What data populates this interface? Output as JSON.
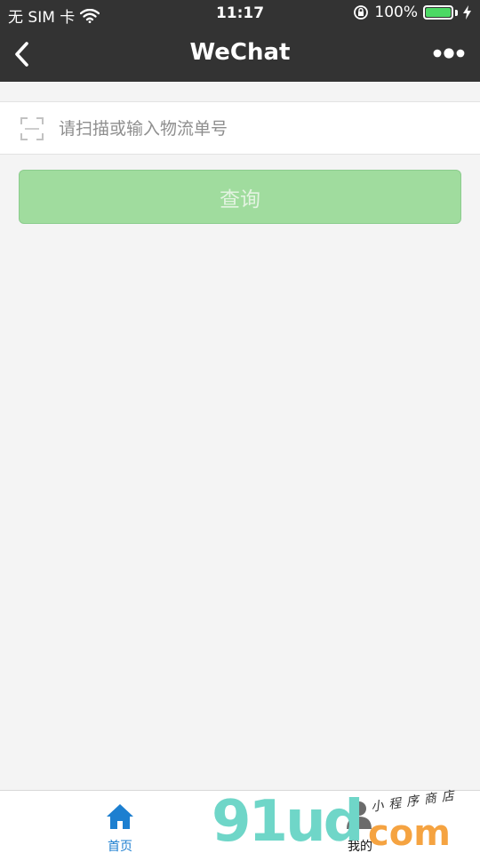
{
  "status_bar": {
    "carrier": "无 SIM 卡",
    "time": "11:17",
    "battery_percent": "100%",
    "battery_level": 1.0,
    "battery_color": "#4cd964",
    "icons": [
      "wifi-icon",
      "rotation-lock-icon",
      "battery-icon",
      "charging-icon"
    ]
  },
  "nav_bar": {
    "title": "WeChat",
    "icons": [
      "back-chevron-icon",
      "more-dots-icon"
    ]
  },
  "search": {
    "placeholder": "请扫描或输入物流单号",
    "value": "",
    "icon": "scan-icon"
  },
  "query_button": {
    "label": "查询",
    "color": "#a0dc9e"
  },
  "tab_bar": {
    "tabs": [
      {
        "label": "首页",
        "icon": "home-icon",
        "active": true,
        "color": "#1d7fd0"
      },
      {
        "label": "我的",
        "icon": "user-icon",
        "active": false
      }
    ]
  },
  "watermark": {
    "brand_left": "91ud",
    "brand_right": "com",
    "tagline": "小程序商店"
  }
}
